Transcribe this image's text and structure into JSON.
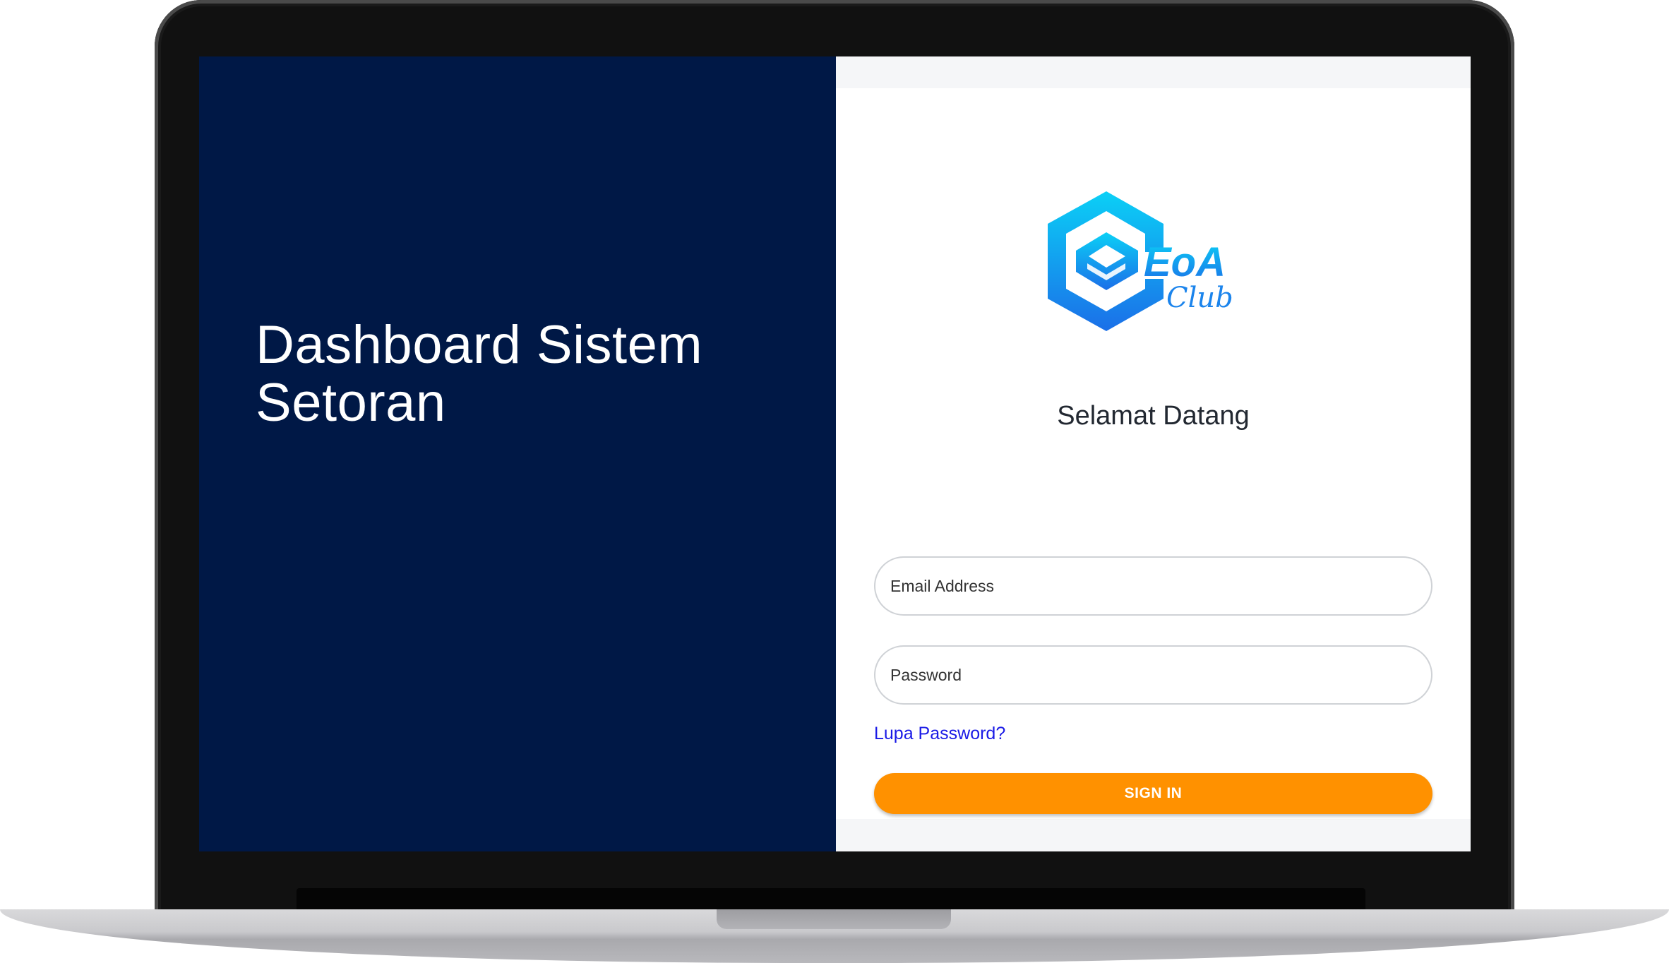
{
  "left_panel": {
    "title": "Dashboard Sistem Setoran"
  },
  "login": {
    "logo_text": "EoA",
    "logo_subtext": "Club",
    "welcome": "Selamat Datang",
    "email_placeholder": "Email Address",
    "password_placeholder": "Password",
    "forgot_password": "Lupa Password?",
    "signin_label": "SIGN IN"
  },
  "colors": {
    "left_panel_bg": "#001846",
    "button_bg": "#ff9100",
    "link": "#1a1ae6",
    "logo_gradient_top": "#08c8f4",
    "logo_gradient_bottom": "#1a72e8"
  },
  "icons": {
    "logo": "eoa-club-hexagon-logo"
  }
}
